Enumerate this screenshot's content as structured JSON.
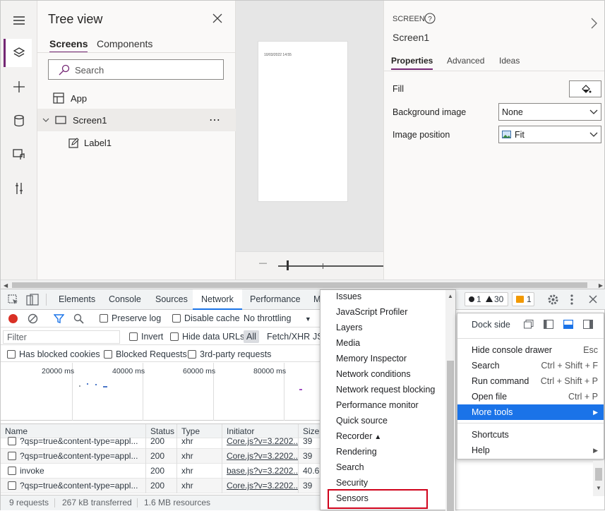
{
  "tree_view": {
    "title": "Tree view",
    "tabs": [
      "Screens",
      "Components"
    ],
    "search_placeholder": "Search",
    "items": [
      {
        "label": "App"
      },
      {
        "label": "Screen1"
      },
      {
        "label": "Label1"
      }
    ],
    "more_glyph": "⋯"
  },
  "canvas": {
    "label_text": "10/03/2022 14:55",
    "zoom_minus": "—"
  },
  "properties": {
    "section": "SCREEN",
    "screen_name": "Screen1",
    "tabs": [
      "Properties",
      "Advanced",
      "Ideas"
    ],
    "fill_label": "Fill",
    "bg_image_label": "Background image",
    "bg_image_value": "None",
    "image_position_label": "Image position",
    "image_position_value": "Fit"
  },
  "devtools": {
    "tabs": [
      "Elements",
      "Console",
      "Sources",
      "Network",
      "Performance",
      "M"
    ],
    "badges": {
      "errors": "1",
      "warnings": "30",
      "issues": "1"
    },
    "toolbar": {
      "preserve_log": "Preserve log",
      "disable_cache": "Disable cache",
      "throttling": "No throttling"
    },
    "filter": {
      "placeholder": "Filter",
      "invert": "Invert",
      "hide_data_urls": "Hide data URLs",
      "all": "All",
      "fetch_xhr": "Fetch/XHR",
      "js": "JS"
    },
    "filter2": {
      "blocked_cookies": "Has blocked cookies",
      "blocked_requests": "Blocked Requests",
      "third_party": "3rd-party requests"
    },
    "timeline_ticks": [
      "20000 ms",
      "40000 ms",
      "60000 ms",
      "80000 ms"
    ],
    "table": {
      "headers": [
        "Name",
        "Status",
        "Type",
        "Initiator",
        "Size"
      ],
      "rows": [
        {
          "name": "?qsp=true&content-type=appl...",
          "status": "200",
          "type": "xhr",
          "initiator": "Core.js?v=3.2202...",
          "size": "39"
        },
        {
          "name": "?qsp=true&content-type=appl...",
          "status": "200",
          "type": "xhr",
          "initiator": "Core.js?v=3.2202...",
          "size": "39"
        },
        {
          "name": "invoke",
          "status": "200",
          "type": "xhr",
          "initiator": "base.js?v=3.2202...",
          "size": "40.6"
        },
        {
          "name": "?qsp=true&content-type=appl...",
          "status": "200",
          "type": "xhr",
          "initiator": "Core.js?v=3.2202...",
          "size": "39"
        }
      ]
    },
    "status_bar": {
      "requests": "9 requests",
      "transferred": "267 kB transferred",
      "resources": "1.6 MB resources"
    },
    "more_tools_menu": [
      "Issues",
      "JavaScript Profiler",
      "Layers",
      "Media",
      "Memory Inspector",
      "Network conditions",
      "Network request blocking",
      "Performance monitor",
      "Quick source",
      "Recorder",
      "Rendering",
      "Search",
      "Security",
      "Sensors"
    ],
    "customize_menu": {
      "dock_side": "Dock side",
      "items": [
        {
          "label": "Hide console drawer",
          "shortcut": "Esc"
        },
        {
          "label": "Search",
          "shortcut": "Ctrl + Shift + F"
        },
        {
          "label": "Run command",
          "shortcut": "Ctrl + Shift + P"
        },
        {
          "label": "Open file",
          "shortcut": "Ctrl + P"
        },
        {
          "label": "More tools",
          "shortcut": ""
        }
      ],
      "items2": [
        {
          "label": "Shortcuts"
        },
        {
          "label": "Help"
        }
      ]
    },
    "colors": {
      "highlight": "#1a73e8",
      "sensors_box": "#d0021b",
      "accent": "#742774"
    }
  }
}
